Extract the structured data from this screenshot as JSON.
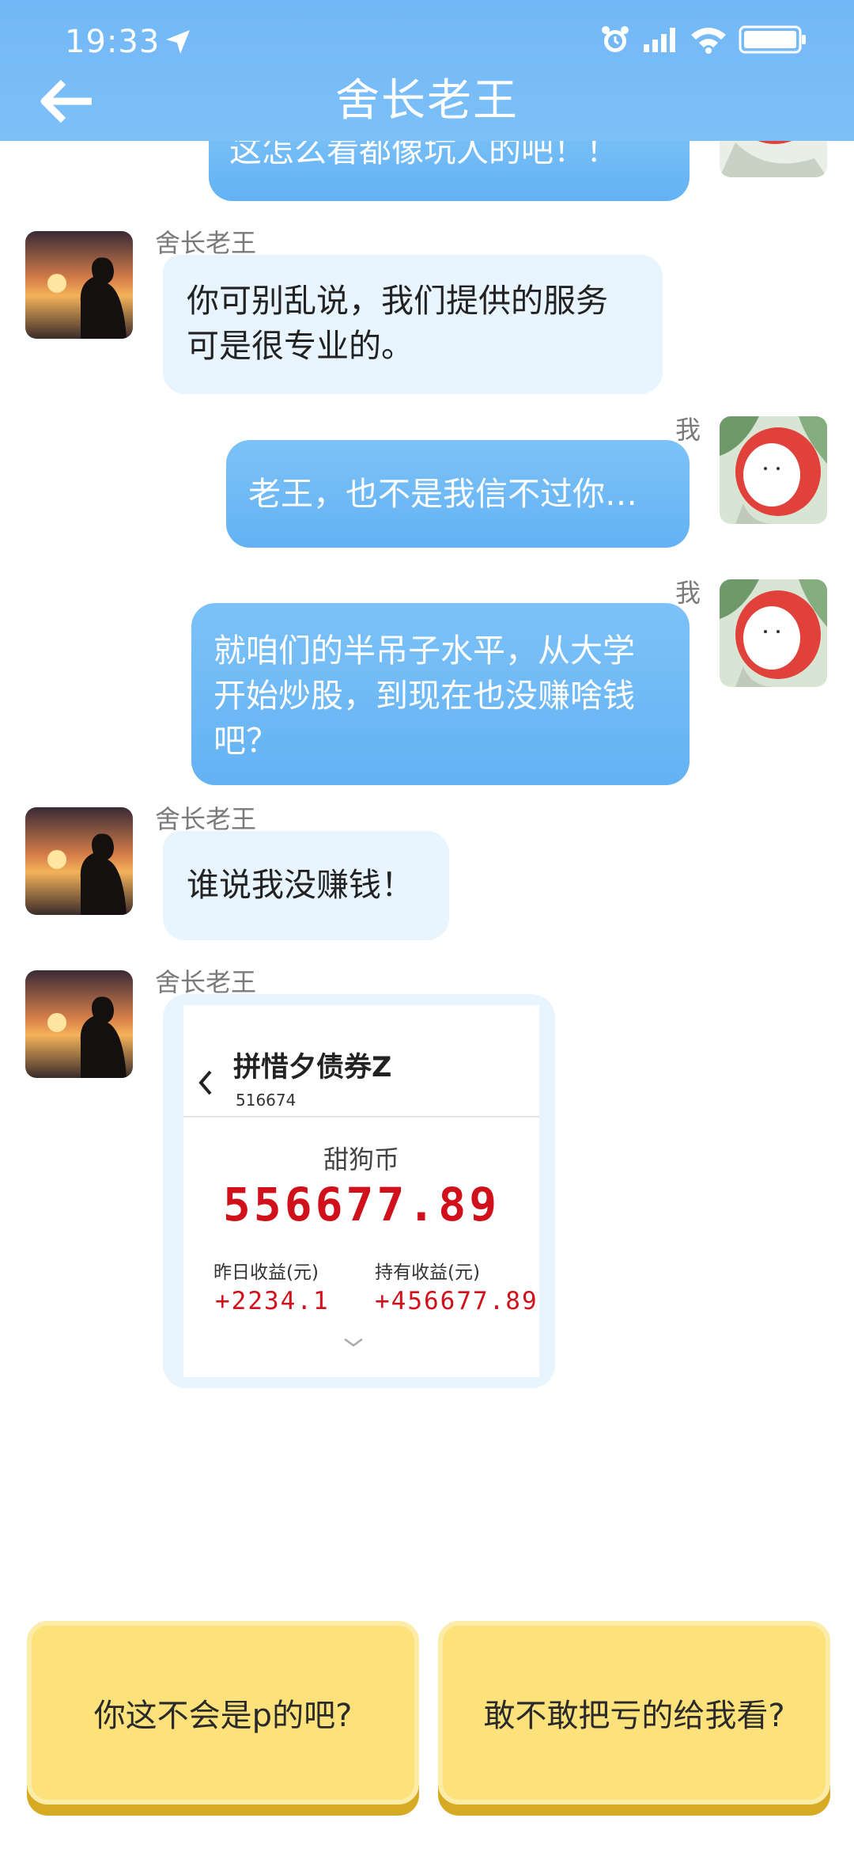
{
  "status_bar": {
    "time": "19:33"
  },
  "header": {
    "title": "舍长老王"
  },
  "messages": [
    {
      "from": "me",
      "text": "这怎么看都像坑人的吧！！"
    },
    {
      "from": "other",
      "name": "舍长老王",
      "lines": [
        "你可别乱说，我们提供的服务",
        "可是很专业的。"
      ]
    },
    {
      "from": "me",
      "name": "我",
      "lines": [
        "老王，也不是我信不过你…"
      ]
    },
    {
      "from": "me",
      "name": "我",
      "lines": [
        "就咱们的半吊子水平，从大学",
        "开始炒股，到现在也没赚啥钱",
        "吧？"
      ]
    },
    {
      "from": "other",
      "name": "舍长老王",
      "lines": [
        "谁说我没赚钱！"
      ]
    },
    {
      "from": "other",
      "name": "舍长老王",
      "card": {
        "fund_name": "拼惜夕债券Z",
        "fund_code": "516674",
        "currency_label": "甜狗币",
        "amount": "556677.89",
        "yesterday_label": "昨日收益(元)",
        "yesterday_value": "+2234.1",
        "holding_label": "持有收益(元)",
        "holding_value": "+456677.89"
      }
    }
  ],
  "choices": [
    "你这不会是p的吧?",
    "敢不敢把亏的给我看?"
  ],
  "colors": {
    "header": "#72b8f6",
    "bubble_me": "#6ab6f5",
    "bubble_other": "#e8f4fe",
    "amount": "#d0111b",
    "choice": "#fde27c"
  }
}
